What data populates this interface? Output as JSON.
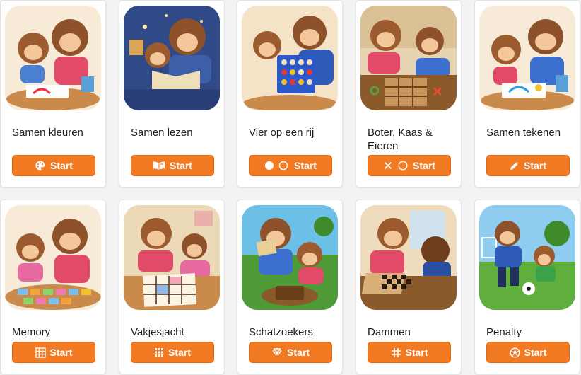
{
  "accent_color": "#f27a22",
  "cards": [
    {
      "title": "Samen kleuren",
      "button": "Start",
      "icon": "palette-icon"
    },
    {
      "title": "Samen lezen",
      "button": "Start",
      "icon": "book-icon"
    },
    {
      "title": "Vier op een rij",
      "button": "Start",
      "icon": "circle-pair-icon"
    },
    {
      "title": "Boter, Kaas & Eieren",
      "button": "Start",
      "icon": "x-circle-icon"
    },
    {
      "title": "Samen tekenen",
      "button": "Start",
      "icon": "pencil-icon"
    },
    {
      "title": "Memory",
      "button": "Start",
      "icon": "grid-icon"
    },
    {
      "title": "Vakjesjacht",
      "button": "Start",
      "icon": "dots-grid-icon"
    },
    {
      "title": "Schatzoekers",
      "button": "Start",
      "icon": "gem-icon"
    },
    {
      "title": "Dammen",
      "button": "Start",
      "icon": "hashtag-icon"
    },
    {
      "title": "Penalty",
      "button": "Start",
      "icon": "soccer-ball-icon"
    }
  ]
}
